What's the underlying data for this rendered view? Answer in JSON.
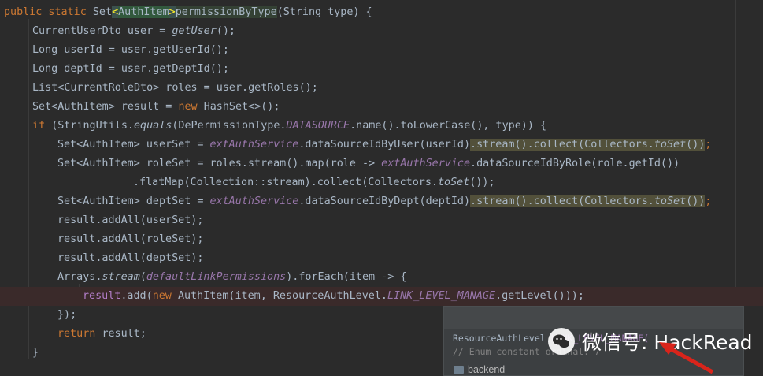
{
  "editor": {
    "lines": [
      {
        "segs": [
          [
            "kw",
            "public static "
          ],
          [
            "",
            "Set"
          ],
          [
            "brk",
            "<"
          ],
          [
            "tag",
            "AuthItem"
          ],
          [
            "brk",
            ">"
          ],
          [
            "",
            ""
          ],
          [
            "mhl",
            "permissionByType"
          ],
          [
            "",
            "(String type) {"
          ]
        ]
      },
      {
        "segs": [
          [
            "",
            "CurrentUserDto user = "
          ],
          [
            "st",
            "getUser"
          ],
          [
            "",
            "();"
          ]
        ]
      },
      {
        "segs": [
          [
            "",
            "Long userId = user.getUserId();"
          ]
        ]
      },
      {
        "segs": [
          [
            "",
            "Long deptId = user.getDeptId();"
          ]
        ]
      },
      {
        "segs": [
          [
            "",
            "List<CurrentRoleDto> roles = user.getRoles();"
          ]
        ]
      },
      {
        "segs": [
          [
            "",
            "Set<AuthItem> result = "
          ],
          [
            "kw",
            "new "
          ],
          [
            "",
            "HashSet<>();"
          ]
        ]
      },
      {
        "segs": [
          [
            "kw",
            "if "
          ],
          [
            "",
            "(StringUtils."
          ],
          [
            "st",
            "equals"
          ],
          [
            "",
            "(DePermissionType."
          ],
          [
            "cn",
            "DATASOURCE"
          ],
          [
            "",
            ".name().toLowerCase(), type)) {"
          ]
        ]
      },
      {
        "segs": [
          [
            "",
            "Set<AuthItem> userSet = "
          ],
          [
            "fld",
            "extAuthService"
          ],
          [
            "",
            ".dataSourceIdByUser(userId)"
          ],
          [
            "wrn",
            ".stream().collect(Collectors."
          ],
          [
            "wrn st",
            "toSet"
          ],
          [
            "wrn",
            "())"
          ],
          [
            "kw",
            ";"
          ]
        ]
      },
      {
        "segs": [
          [
            "",
            "Set<AuthItem> roleSet = roles.stream().map(role -> "
          ],
          [
            "fld",
            "extAuthService"
          ],
          [
            "",
            ".dataSourceIdByRole(role.getId())"
          ]
        ]
      },
      {
        "segs": [
          [
            "",
            ".flatMap(Collection::stream).collect(Collectors."
          ],
          [
            "st",
            "toSet"
          ],
          [
            "",
            "());"
          ]
        ]
      },
      {
        "segs": [
          [
            "",
            "Set<AuthItem> deptSet = "
          ],
          [
            "fld",
            "extAuthService"
          ],
          [
            "",
            ".dataSourceIdByDept(deptId)"
          ],
          [
            "wrn",
            ".stream().collect(Collectors."
          ],
          [
            "wrn st",
            "toSet"
          ],
          [
            "wrn",
            "())"
          ],
          [
            "kw",
            ";"
          ]
        ]
      },
      {
        "segs": [
          [
            "",
            "result.addAll(userSet);"
          ]
        ]
      },
      {
        "segs": [
          [
            "",
            "result.addAll(roleSet);"
          ]
        ]
      },
      {
        "segs": [
          [
            "",
            "result.addAll(deptSet);"
          ]
        ]
      },
      {
        "segs": [
          [
            "",
            "Arrays."
          ],
          [
            "st",
            "stream"
          ],
          [
            "",
            "("
          ],
          [
            "fld",
            "defaultLinkPermissions"
          ],
          [
            "",
            ").forEach(item -> {"
          ]
        ]
      },
      {
        "segs": [
          [
            "rv",
            "result"
          ],
          [
            "",
            ".add("
          ],
          [
            "kw",
            "new "
          ],
          [
            "",
            "AuthItem(item, ResourceAuthLevel."
          ],
          [
            "cn",
            "LINK_LEVEL_MANAGE"
          ],
          [
            "",
            ".getLevel()));"
          ]
        ]
      },
      {
        "segs": [
          [
            "",
            "});"
          ]
        ]
      },
      {
        "segs": [
          [
            "kw",
            "return "
          ],
          [
            "",
            "result;"
          ]
        ]
      },
      {
        "segs": [
          [
            "",
            "}"
          ]
        ]
      }
    ]
  },
  "popup": {
    "signature_prefix": "ResourceAuthLevel ",
    "signature_name": "LINK_LEVEL_MANAGE(",
    "comment": "// Enum constant ordinal: 7",
    "folder_label": "backend"
  },
  "watermark": {
    "text": "微信号: HackRead"
  }
}
